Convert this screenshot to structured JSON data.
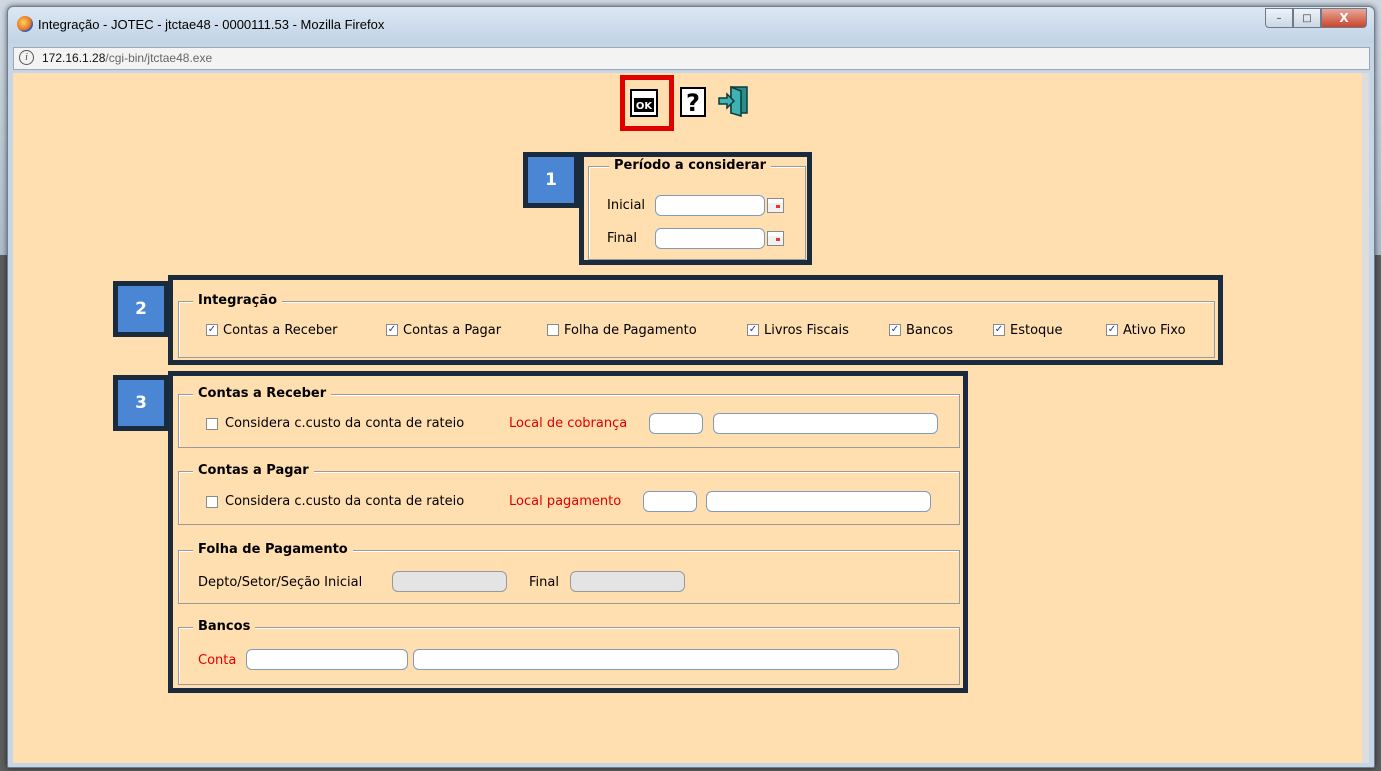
{
  "window": {
    "title": "Integração - JOTEC - jtctae48 - 0000111.53 - Mozilla Firefox",
    "url_host": "172.16.1.28",
    "url_path": "/cgi-bin/jtctae48.exe",
    "minimize": "–",
    "maximize": "□",
    "close": "X"
  },
  "toolbar": {
    "ok_icon": "ok-icon",
    "help_icon": "help-icon",
    "exit_icon": "exit-icon"
  },
  "markers": {
    "one": "1",
    "two": "2",
    "three": "3"
  },
  "periodo": {
    "legend": "Período a considerar",
    "inicial_label": "Inicial",
    "final_label": "Final",
    "inicial_value": "",
    "final_value": ""
  },
  "integracao": {
    "legend": "Integração",
    "options": [
      {
        "label": "Contas a Receber",
        "checked": true
      },
      {
        "label": "Contas a Pagar",
        "checked": true
      },
      {
        "label": "Folha de Pagamento",
        "checked": false
      },
      {
        "label": "Livros Fiscais",
        "checked": true
      },
      {
        "label": "Bancos",
        "checked": true
      },
      {
        "label": "Estoque",
        "checked": true
      },
      {
        "label": "Ativo Fixo",
        "checked": true
      }
    ]
  },
  "receber": {
    "legend": "Contas a Receber",
    "check_label": "Considera c.custo da conta de rateio",
    "local_label": "Local de cobrança"
  },
  "pagar": {
    "legend": "Contas a Pagar",
    "check_label": "Considera c.custo da conta de rateio",
    "local_label": "Local pagamento"
  },
  "folha": {
    "legend": "Folha de Pagamento",
    "inicial_label": "Depto/Setor/Seção Inicial",
    "final_label": "Final"
  },
  "bancos": {
    "legend": "Bancos",
    "conta_label": "Conta"
  },
  "colors": {
    "background": "#ffdeb0",
    "highlight_ok": "#e00000",
    "marker_fill": "#4a86d4",
    "marker_border": "#1b2b3e",
    "required_label": "#e00000"
  }
}
